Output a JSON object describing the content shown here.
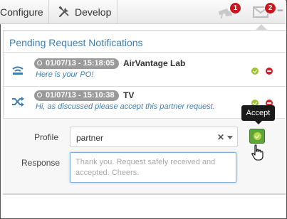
{
  "topbar": {
    "tabs": [
      {
        "label": "Configure"
      },
      {
        "label": "Develop",
        "icon": "tools-icon"
      }
    ],
    "flag_badge": "1",
    "mail_badge": "2"
  },
  "panel": {
    "title": "Pending Request Notifications",
    "notifications": [
      {
        "icon": "wifi-icon",
        "timestamp": "01/07/13 - 15:18:05",
        "sender": "AirVantage Lab",
        "message": "Here is your PO!"
      },
      {
        "icon": "shuffle-icon",
        "timestamp": "01/07/13 - 15:10:38",
        "sender": "TV",
        "message": "Hi, as discussed please accept this partner request."
      }
    ]
  },
  "form": {
    "profile_label": "Profile",
    "profile_value": "partner",
    "response_label": "Response",
    "response_text": "Thank you. Request safely received and accepted. Cheers."
  },
  "tooltip": "Accept",
  "colors": {
    "accent": "#3d7fb0",
    "badge": "#c9161d",
    "accept": "#5fa53b",
    "reject": "#d1212a"
  }
}
